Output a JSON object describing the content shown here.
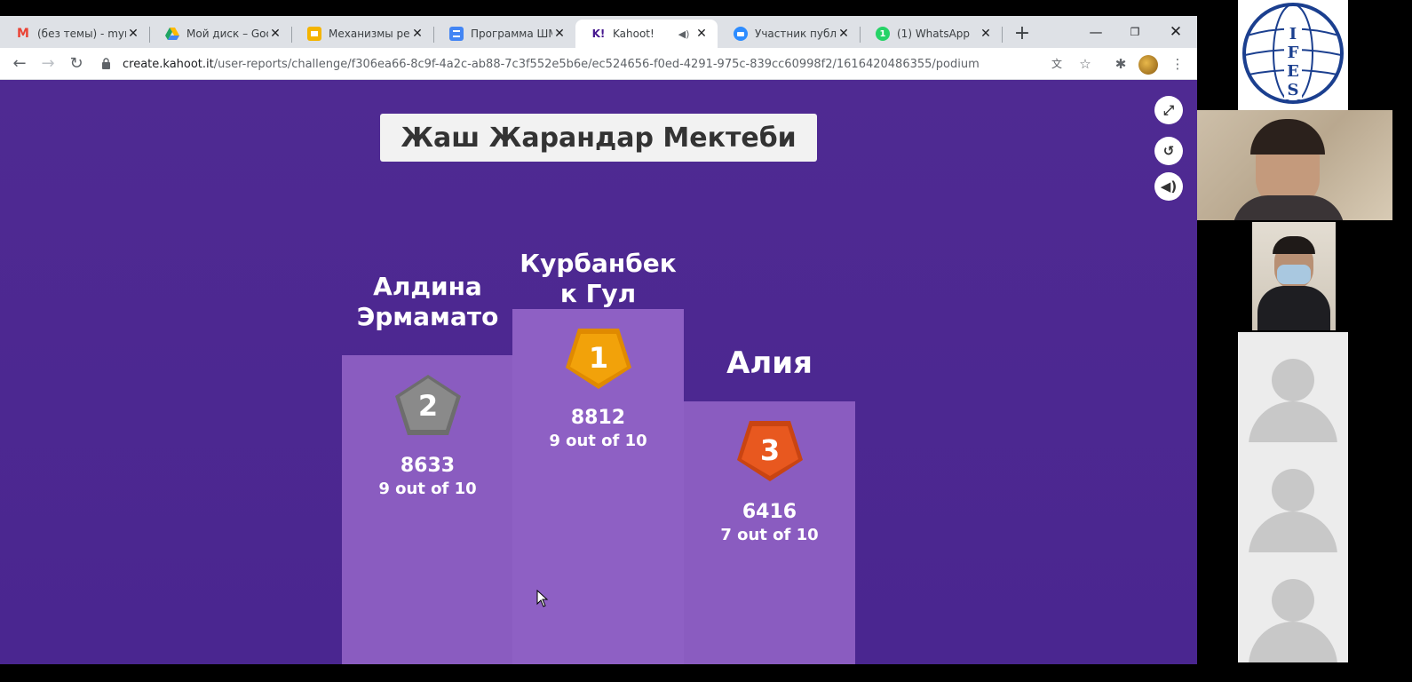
{
  "tabs": [
    {
      "label": "(без темы) - myrz",
      "icon": "gmail-icon",
      "color": "#ea4335"
    },
    {
      "label": "Мой диск – Googl",
      "icon": "drive-icon",
      "color": "#1fa463"
    },
    {
      "label": "Механизмы реал",
      "icon": "slides-icon",
      "color": "#f4b400"
    },
    {
      "label": "Программа ШМГ",
      "icon": "docs-icon",
      "color": "#4285f4"
    },
    {
      "label": "Kahoot!",
      "icon": "kahoot-icon",
      "color": "#46178f",
      "fav_text": "K!"
    },
    {
      "label": "Участник публика",
      "icon": "zoom-icon",
      "color": "#2d8cff"
    },
    {
      "label": "(1) WhatsApp",
      "icon": "whatsapp-icon",
      "color": "#25d366",
      "fav_text": "1"
    }
  ],
  "address_bar": {
    "host": "create.kahoot.it",
    "path": "/user-reports/challenge/f306ea66-8c9f-4a2c-ab88-7c3f552e5b6e/ec524656-f0ed-4291-975c-839cc60998f2/1616420486355/podium"
  },
  "kahoot": {
    "title": "Жаш Жарандар Мектеби",
    "first": {
      "name": "Курбанбек к Гул",
      "rank": "1",
      "score": "8812",
      "correct": "9 out of 10"
    },
    "second": {
      "name": "Алдина Эрмамато",
      "rank": "2",
      "score": "8633",
      "correct": "9 out of 10"
    },
    "third": {
      "name": "Алия",
      "rank": "3",
      "score": "6416",
      "correct": "7 out of 10"
    }
  },
  "video_panel": {
    "logo_text": "IFES"
  },
  "colors": {
    "kahoot_bg": "#4f2a92",
    "podium": "#8a5cc0",
    "gold": "#f2a20a",
    "silver": "#8a8a8a",
    "bronze": "#e8581f"
  }
}
